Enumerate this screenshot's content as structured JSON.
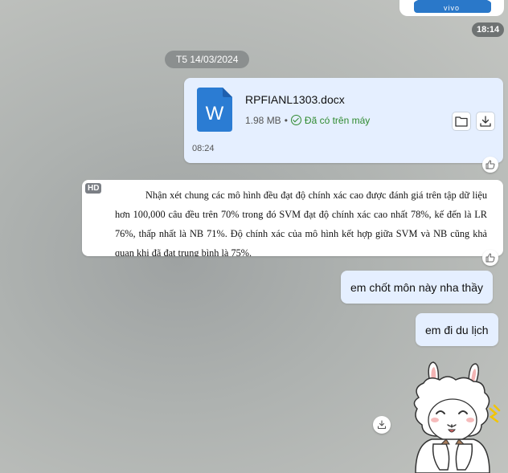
{
  "top_sticker": {
    "brand": "vivo"
  },
  "messages": {
    "sticker_time": "18:14",
    "date_separator": "T5 14/03/2024",
    "file": {
      "icon_letter": "W",
      "name": "RPFIANL1303.docx",
      "size": "1.98 MB",
      "separator": "•",
      "status": "Đã có trên máy",
      "time": "08:24"
    },
    "image_message": {
      "badge": "HD",
      "text": "Nhận xét chung các mô hình đều đạt độ chính xác cao được đánh giá trên tập dữ liệu hơn 100,000 câu đều trên 70% trong đó SVM đạt độ chính xác cao nhất 78%, kế đến là LR 76%, thấp nhất là NB 71%. Độ chính xác của mô hình kết hợp giữa SVM và NB cũng khả quan khi đã đạt trung bình là 75%."
    },
    "text_messages": [
      "em chốt môn này nha thầy",
      "em đi du lịch"
    ]
  },
  "colors": {
    "bubble_bg": "#e5efff",
    "word_blue": "#2b7cd3",
    "saved_green": "#2f8a2f"
  }
}
